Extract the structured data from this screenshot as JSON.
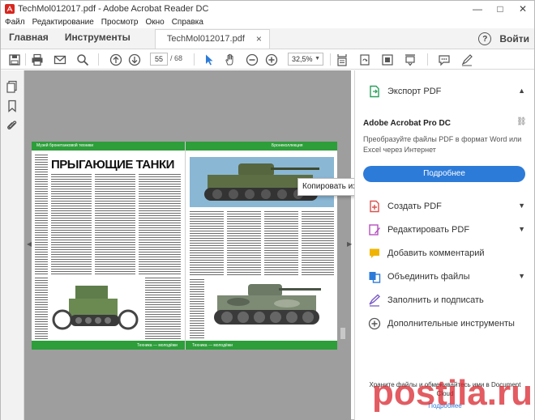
{
  "window": {
    "title": "TechMol012017.pdf - Adobe Acrobat Reader DC",
    "minimize": "—",
    "maximize": "□",
    "close": "✕"
  },
  "menu": [
    "Файл",
    "Редактирование",
    "Просмотр",
    "Окно",
    "Справка"
  ],
  "tabs": {
    "home": "Главная",
    "tools": "Инструменты",
    "document": "TechMol012017.pdf",
    "document_close": "×",
    "help": "?",
    "signin": "Войти"
  },
  "toolbar": {
    "current_page": "55",
    "page_total": "/ 68",
    "zoom": "32,5%",
    "zoom_caret": "▼",
    "icons": [
      "save-icon",
      "print-icon",
      "email-icon",
      "search-icon",
      "page-up-icon",
      "page-down-icon",
      "select-arrow-icon",
      "hand-icon",
      "zoom-out-icon",
      "zoom-in-icon",
      "fit-page-icon",
      "rotate-icon",
      "full-screen-icon",
      "scroll-mode-icon",
      "comment-icon",
      "sign-icon"
    ]
  },
  "document": {
    "article_title": "ПРЫГАЮЩИЕ ТАНКИ",
    "left_header": "Музей бронетанковой техники",
    "right_header": "Бронеколлекция",
    "footer_left": "Техника — молодёжи",
    "footer_right": "Техника — молодёжи"
  },
  "context_menu": {
    "item": "Копировать изображение"
  },
  "right_pane": {
    "export": "Экспорт PDF",
    "promo_title": "Adobe Acrobat Pro DC",
    "promo_desc": "Преобразуйте файлы PDF в формат Word или Excel через Интернет",
    "promo_button": "Подробнее",
    "tools": [
      {
        "label": "Создать PDF",
        "icon": "create-pdf-icon",
        "color": "#d9534f"
      },
      {
        "label": "Редактировать PDF",
        "icon": "edit-pdf-icon",
        "color": "#b64fbf"
      },
      {
        "label": "Добавить комментарий",
        "icon": "comment-icon",
        "color": "#f0b400"
      },
      {
        "label": "Объединить файлы",
        "icon": "combine-icon",
        "color": "#2d7bd8"
      },
      {
        "label": "Заполнить и подписать",
        "icon": "fill-sign-icon",
        "color": "#7b5cc7"
      },
      {
        "label": "Дополнительные инструменты",
        "icon": "more-tools-icon",
        "color": "#555555"
      }
    ],
    "bottom_note": "Храните файлы и обменивайтесь ими в Document Cloud",
    "bottom_link": "Подробнее"
  },
  "watermark": "postila.ru",
  "colors": {
    "accent": "#2d7bd8",
    "magazine_green": "#2d9e3a",
    "doc_background": "#9e9e9e"
  }
}
